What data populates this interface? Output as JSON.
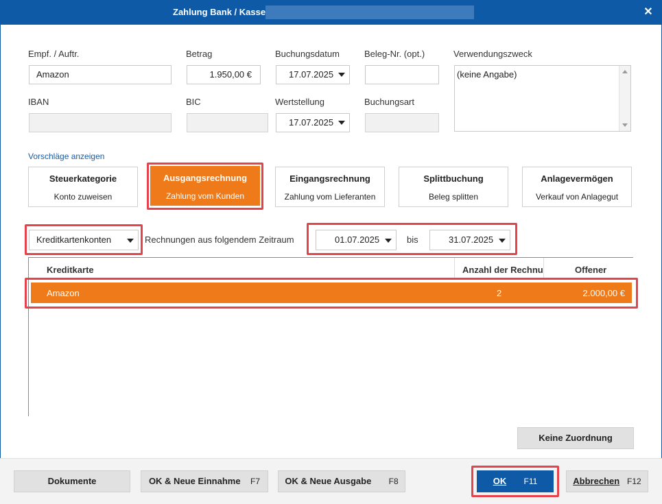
{
  "window": {
    "title": "Zahlung Bank / Kasse",
    "close_icon": "close-icon",
    "close_glyph": "✕"
  },
  "form": {
    "recipient": {
      "label": "Empf. / Auftr.",
      "value": "Amazon"
    },
    "amount": {
      "label": "Betrag",
      "value": "1.950,00 €"
    },
    "booking_date": {
      "label": "Buchungsdatum",
      "value": "17.07.2025"
    },
    "receipt_no": {
      "label": "Beleg-Nr. (opt.)",
      "value": ""
    },
    "purpose": {
      "label": "Verwendungszweck",
      "value": "(keine Angabe)"
    },
    "iban": {
      "label": "IBAN",
      "value": ""
    },
    "bic": {
      "label": "BIC",
      "value": ""
    },
    "value_date": {
      "label": "Wertstellung",
      "value": "17.07.2025"
    },
    "booking_type": {
      "label": "Buchungsart",
      "value": ""
    }
  },
  "suggestions": {
    "link": "Vorschläge anzeigen",
    "cards": [
      {
        "title": "Steuerkategorie",
        "subtitle": "Konto zuweisen"
      },
      {
        "title": "Ausgangsrechnung",
        "subtitle": "Zahlung vom Kunden"
      },
      {
        "title": "Eingangsrechnung",
        "subtitle": "Zahlung vom Lieferanten"
      },
      {
        "title": "Splittbuchung",
        "subtitle": "Beleg splitten"
      },
      {
        "title": "Anlagevermögen",
        "subtitle": "Verkauf von Anlagegut"
      }
    ],
    "active_index": 1
  },
  "filter": {
    "account_type": "Kreditkartenkonten",
    "period_label": "Rechnungen aus folgendem Zeitraum",
    "from": "01.07.2025",
    "to_label": "bis",
    "to": "31.07.2025"
  },
  "table": {
    "columns": [
      "Kreditkarte",
      "Anzahl der Rechnu",
      "Offener Saldo"
    ],
    "rows": [
      {
        "name": "Amazon",
        "count": "2",
        "balance": "2.000,00 €"
      }
    ]
  },
  "buttons": {
    "no_assignment": "Keine Zuordnung",
    "documents": "Dokumente",
    "ok_new_income": "OK & Neue Einnahme",
    "ok_new_income_key": "F7",
    "ok_new_expense": "OK & Neue Ausgabe",
    "ok_new_expense_key": "F8",
    "ok": "OK",
    "ok_key": "F11",
    "cancel": "Abbrechen",
    "cancel_key": "F12"
  },
  "colors": {
    "titlebar": "#0f5aa6",
    "accent_orange": "#ef7a1a",
    "highlight_red": "#e5424c"
  }
}
